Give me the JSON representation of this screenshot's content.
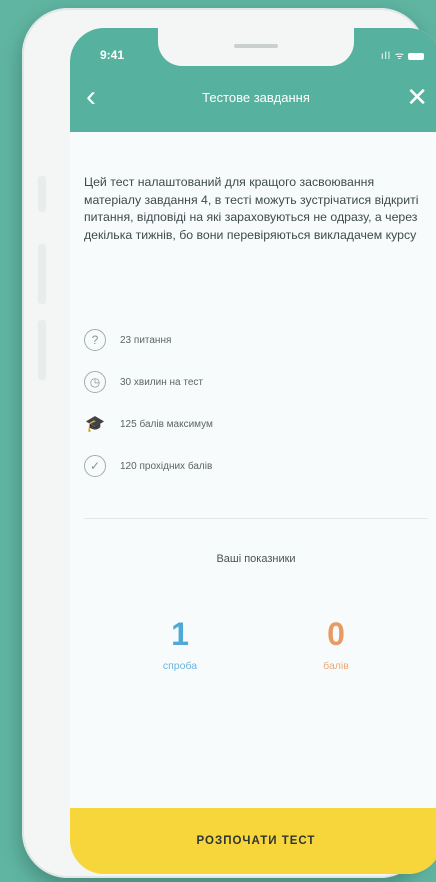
{
  "status_bar": {
    "time": "9:41",
    "signal": "ıll ᯤ"
  },
  "nav": {
    "back_glyph": "‹",
    "title": "Тестове завдання",
    "close_glyph": "✕"
  },
  "description": "Цей тест налаштований для кращого засвоювання матеріалу завдання 4, в тесті можуть зустрічатися відкриті питання, відповіді на які зараховуються не одразу, а через декілька тижнів, бо вони перевіряються викладачем курсу",
  "info": [
    {
      "icon": "question-icon",
      "glyph": "?",
      "text": "23 питання"
    },
    {
      "icon": "clock-icon",
      "glyph": "◷",
      "text": "30 хвилин на тест"
    },
    {
      "icon": "graduation-cap-icon",
      "glyph": "🎓",
      "text": "125 балів максимум"
    },
    {
      "icon": "check-icon",
      "glyph": "✓",
      "text": "120 прохідних балів"
    }
  ],
  "stats": {
    "title": "Ваші показники",
    "attempts": {
      "value": "1",
      "label": "спроба"
    },
    "points": {
      "value": "0",
      "label": "балів"
    }
  },
  "colors": {
    "header": "#56b29e",
    "attempts": "#4fa9d6",
    "points": "#e99a62",
    "cta": "#f6d63a"
  },
  "cta": {
    "label": "РОЗПОЧАТИ ТЕСТ"
  }
}
